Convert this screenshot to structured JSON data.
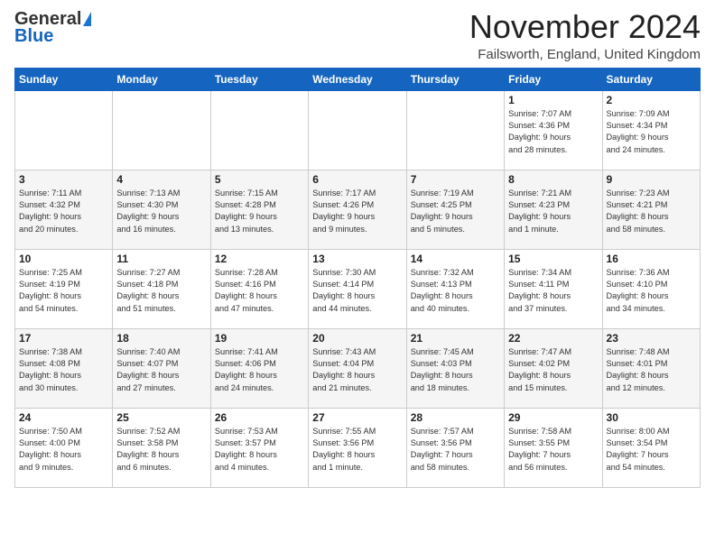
{
  "header": {
    "logo_general": "General",
    "logo_blue": "Blue",
    "month": "November 2024",
    "location": "Failsworth, England, United Kingdom"
  },
  "weekdays": [
    "Sunday",
    "Monday",
    "Tuesday",
    "Wednesday",
    "Thursday",
    "Friday",
    "Saturday"
  ],
  "weeks": [
    [
      {
        "day": "",
        "info": ""
      },
      {
        "day": "",
        "info": ""
      },
      {
        "day": "",
        "info": ""
      },
      {
        "day": "",
        "info": ""
      },
      {
        "day": "",
        "info": ""
      },
      {
        "day": "1",
        "info": "Sunrise: 7:07 AM\nSunset: 4:36 PM\nDaylight: 9 hours\nand 28 minutes."
      },
      {
        "day": "2",
        "info": "Sunrise: 7:09 AM\nSunset: 4:34 PM\nDaylight: 9 hours\nand 24 minutes."
      }
    ],
    [
      {
        "day": "3",
        "info": "Sunrise: 7:11 AM\nSunset: 4:32 PM\nDaylight: 9 hours\nand 20 minutes."
      },
      {
        "day": "4",
        "info": "Sunrise: 7:13 AM\nSunset: 4:30 PM\nDaylight: 9 hours\nand 16 minutes."
      },
      {
        "day": "5",
        "info": "Sunrise: 7:15 AM\nSunset: 4:28 PM\nDaylight: 9 hours\nand 13 minutes."
      },
      {
        "day": "6",
        "info": "Sunrise: 7:17 AM\nSunset: 4:26 PM\nDaylight: 9 hours\nand 9 minutes."
      },
      {
        "day": "7",
        "info": "Sunrise: 7:19 AM\nSunset: 4:25 PM\nDaylight: 9 hours\nand 5 minutes."
      },
      {
        "day": "8",
        "info": "Sunrise: 7:21 AM\nSunset: 4:23 PM\nDaylight: 9 hours\nand 1 minute."
      },
      {
        "day": "9",
        "info": "Sunrise: 7:23 AM\nSunset: 4:21 PM\nDaylight: 8 hours\nand 58 minutes."
      }
    ],
    [
      {
        "day": "10",
        "info": "Sunrise: 7:25 AM\nSunset: 4:19 PM\nDaylight: 8 hours\nand 54 minutes."
      },
      {
        "day": "11",
        "info": "Sunrise: 7:27 AM\nSunset: 4:18 PM\nDaylight: 8 hours\nand 51 minutes."
      },
      {
        "day": "12",
        "info": "Sunrise: 7:28 AM\nSunset: 4:16 PM\nDaylight: 8 hours\nand 47 minutes."
      },
      {
        "day": "13",
        "info": "Sunrise: 7:30 AM\nSunset: 4:14 PM\nDaylight: 8 hours\nand 44 minutes."
      },
      {
        "day": "14",
        "info": "Sunrise: 7:32 AM\nSunset: 4:13 PM\nDaylight: 8 hours\nand 40 minutes."
      },
      {
        "day": "15",
        "info": "Sunrise: 7:34 AM\nSunset: 4:11 PM\nDaylight: 8 hours\nand 37 minutes."
      },
      {
        "day": "16",
        "info": "Sunrise: 7:36 AM\nSunset: 4:10 PM\nDaylight: 8 hours\nand 34 minutes."
      }
    ],
    [
      {
        "day": "17",
        "info": "Sunrise: 7:38 AM\nSunset: 4:08 PM\nDaylight: 8 hours\nand 30 minutes."
      },
      {
        "day": "18",
        "info": "Sunrise: 7:40 AM\nSunset: 4:07 PM\nDaylight: 8 hours\nand 27 minutes."
      },
      {
        "day": "19",
        "info": "Sunrise: 7:41 AM\nSunset: 4:06 PM\nDaylight: 8 hours\nand 24 minutes."
      },
      {
        "day": "20",
        "info": "Sunrise: 7:43 AM\nSunset: 4:04 PM\nDaylight: 8 hours\nand 21 minutes."
      },
      {
        "day": "21",
        "info": "Sunrise: 7:45 AM\nSunset: 4:03 PM\nDaylight: 8 hours\nand 18 minutes."
      },
      {
        "day": "22",
        "info": "Sunrise: 7:47 AM\nSunset: 4:02 PM\nDaylight: 8 hours\nand 15 minutes."
      },
      {
        "day": "23",
        "info": "Sunrise: 7:48 AM\nSunset: 4:01 PM\nDaylight: 8 hours\nand 12 minutes."
      }
    ],
    [
      {
        "day": "24",
        "info": "Sunrise: 7:50 AM\nSunset: 4:00 PM\nDaylight: 8 hours\nand 9 minutes."
      },
      {
        "day": "25",
        "info": "Sunrise: 7:52 AM\nSunset: 3:58 PM\nDaylight: 8 hours\nand 6 minutes."
      },
      {
        "day": "26",
        "info": "Sunrise: 7:53 AM\nSunset: 3:57 PM\nDaylight: 8 hours\nand 4 minutes."
      },
      {
        "day": "27",
        "info": "Sunrise: 7:55 AM\nSunset: 3:56 PM\nDaylight: 8 hours\nand 1 minute."
      },
      {
        "day": "28",
        "info": "Sunrise: 7:57 AM\nSunset: 3:56 PM\nDaylight: 7 hours\nand 58 minutes."
      },
      {
        "day": "29",
        "info": "Sunrise: 7:58 AM\nSunset: 3:55 PM\nDaylight: 7 hours\nand 56 minutes."
      },
      {
        "day": "30",
        "info": "Sunrise: 8:00 AM\nSunset: 3:54 PM\nDaylight: 7 hours\nand 54 minutes."
      }
    ]
  ]
}
